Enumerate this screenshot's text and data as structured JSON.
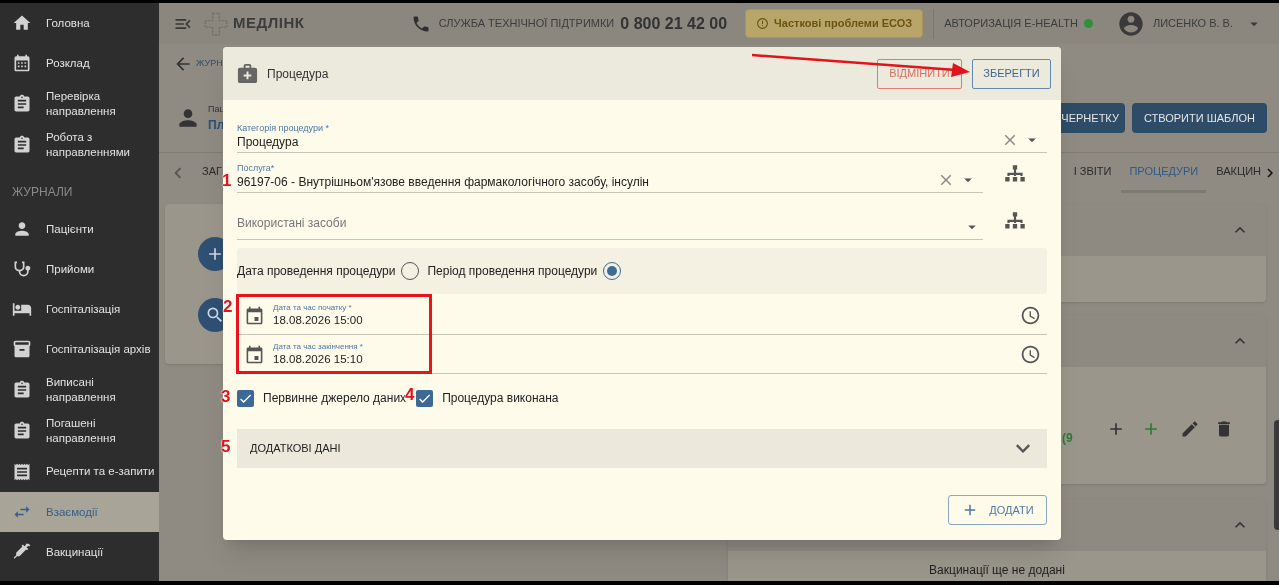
{
  "sidebar": {
    "items": [
      {
        "kind": "item",
        "label": "Головна",
        "selected": false
      },
      {
        "kind": "item",
        "label": "Розклад",
        "selected": false
      },
      {
        "kind": "item",
        "label": "Перевірка направлення",
        "selected": false
      },
      {
        "kind": "item",
        "label": "Робота з направленнями",
        "selected": false
      },
      {
        "kind": "section",
        "label": "ЖУРНАЛИ"
      },
      {
        "kind": "item",
        "label": "Пацієнти",
        "selected": false
      },
      {
        "kind": "item",
        "label": "Прийоми",
        "selected": false
      },
      {
        "kind": "item",
        "label": "Госпіталізація",
        "selected": false
      },
      {
        "kind": "item",
        "label": "Госпіталізація архів",
        "selected": false
      },
      {
        "kind": "item",
        "label": "Виписані направлення",
        "selected": false
      },
      {
        "kind": "item",
        "label": "Погашені направлення",
        "selected": false
      },
      {
        "kind": "item",
        "label": "Рецепти та е-запити",
        "selected": false
      },
      {
        "kind": "item",
        "label": "Взаємодії",
        "selected": true
      },
      {
        "kind": "item",
        "label": "Вакцинації",
        "selected": false
      }
    ]
  },
  "header": {
    "logo": "МЕДЛІНК",
    "support_label": "СЛУЖБА ТЕХНІЧНОЇ ПІДТРИМКИ",
    "support_phone": "0 800 21 42 00",
    "status_badge": "Часткові проблеми ЕСОЗ",
    "auth_label": "АВТОРИЗАЦІЯ E-HEALTH",
    "auth_connected": true,
    "user": "ЛИСЕНКО В. В."
  },
  "page": {
    "breadcrumb": "ЖУРН",
    "patient_label": "Пац",
    "patient_name": "Пл",
    "buttons": [
      "ЧЕРНЕТКУ",
      "СТВОРИТИ ШАБЛОН"
    ],
    "tabs": [
      {
        "label": "ЗАГ",
        "selected": false
      },
      {
        "label": "І ЗВІТИ",
        "selected": false
      },
      {
        "label": "ПРОЦЕДУРИ",
        "selected": true
      },
      {
        "label": "ВАКЦИН",
        "selected": false
      }
    ],
    "count_fragment": "(9",
    "empty_text": "Вакцинації ще не додані"
  },
  "dialog": {
    "title": "Процедура",
    "cancel": "ВІДМІНИТИ",
    "save": "ЗБЕРЕГТИ",
    "fields": [
      {
        "label": "Категорія процедури *",
        "value": "Процедура",
        "clearable": true,
        "tree": false
      },
      {
        "label": "Послуга*",
        "value": "96197-06 - Внутрішньом'язове введення фармакологічного засобу, інсулін",
        "clearable": true,
        "tree": true
      },
      {
        "placeholder": "Використані засоби",
        "clearable": false,
        "tree": true
      }
    ],
    "date_mode": [
      {
        "label": "Дата проведення процедури",
        "selected": false
      },
      {
        "label": "Період проведення процедури",
        "selected": true
      }
    ],
    "dates": [
      {
        "label": "Дата та час початку *",
        "value": "18.08.2026 15:00"
      },
      {
        "label": "Дата та час закінчення *",
        "value": "18.08.2026 15:10"
      }
    ],
    "checkboxes": [
      {
        "label": "Первинне джерело даних",
        "checked": true
      },
      {
        "label": "Процедура виконана",
        "checked": true
      }
    ],
    "accordion": {
      "label": "ДОДАТКОВІ ДАНІ",
      "expanded": false
    },
    "add_button": "ДОДАТИ"
  },
  "annotations": {
    "markers": [
      "1",
      "2",
      "3",
      "4",
      "5"
    ]
  }
}
